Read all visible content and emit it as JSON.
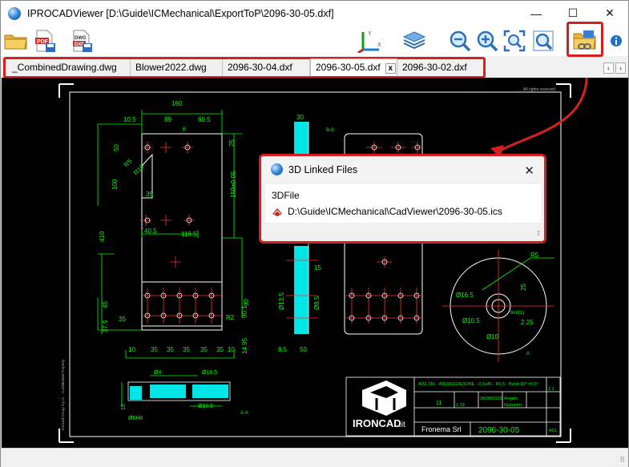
{
  "window": {
    "title": "IPROCADViewer  [D:\\Guide\\ICMechanical\\ExportToP\\2096-30-05.dxf]",
    "minimize_glyph": "—",
    "maximize_glyph": "☐",
    "close_glyph": "✕"
  },
  "toolbar": {
    "buttons": [
      {
        "name": "open-folder-icon"
      },
      {
        "name": "export-pdf-icon"
      },
      {
        "name": "export-dwg-dxf-icon"
      },
      {
        "name": "coordinate-axes-icon"
      },
      {
        "name": "layers-icon"
      },
      {
        "name": "zoom-out-icon"
      },
      {
        "name": "zoom-in-icon"
      },
      {
        "name": "zoom-extents-icon"
      },
      {
        "name": "zoom-window-icon"
      },
      {
        "name": "linked-files-icon"
      },
      {
        "name": "info-icon"
      }
    ],
    "accent": "#d62020"
  },
  "tabs": {
    "items": [
      {
        "label": "_CombinedDrawing.dwg",
        "active": false
      },
      {
        "label": "Blower2022.dwg",
        "active": false
      },
      {
        "label": "2096-30-04.dxf",
        "active": false
      },
      {
        "label": "2096-30-05.dxf",
        "active": true
      },
      {
        "label": "2096-30-02.dxf",
        "active": false
      }
    ],
    "close_glyph": "x",
    "scroll_left": "‹",
    "scroll_right": "›"
  },
  "drawing": {
    "dims_top": [
      "160",
      "10.5",
      "89",
      "60.5",
      "B"
    ],
    "dims_left": [
      "50",
      "R5",
      "R10",
      "100",
      "35",
      "410",
      "40.5",
      "119.5",
      "37.5",
      "45",
      "35",
      "10"
    ],
    "dims_bottom": [
      "35",
      "35",
      "35",
      "35",
      "35",
      "10"
    ],
    "dims_right": [
      "25",
      "150±0.05",
      "90",
      "R2",
      "90.1",
      "14.95"
    ],
    "side_view_dims": [
      "30",
      "B-B",
      "15",
      "Ø13.5",
      "Ø8.5",
      "8.5",
      "50"
    ],
    "section_dims": [
      "Ø4",
      "Ø16.5",
      "Ø10.5",
      "Ø6H8",
      "15",
      "A-A"
    ],
    "detail_dims": [
      "R5",
      "Ø16.5",
      "25",
      "Ø10.5",
      "6mf(1)",
      "2.25",
      "A",
      "Ø10"
    ],
    "title_block": {
      "company": "IRONCAD",
      "company_suffix": ".it",
      "material": "AISI 316 - ANODIZZAZIONE - 0.5x45 - R0.5 - Bordi 90° ±0.5°",
      "client": "Fronema Srl",
      "drawing_no": "2096-30-05",
      "scale": "1:1",
      "sheet": "A01",
      "date": "28/08/2026",
      "designer": "Angelo",
      "checker": "Giovanni",
      "qty": "11",
      "rev": "2.19"
    },
    "copyright": "All rights reserved",
    "side_note": "Ironcad Group S.p.A. - Confidential Property",
    "line_color": "#00ff00",
    "center_color": "#ff3030",
    "part_color": "#ffffff",
    "cyan_color": "#00e5e5"
  },
  "dialog": {
    "title": "3D Linked Files",
    "close_glyph": "✕",
    "column_label": "3DFile",
    "file_path": "D:\\Guide\\ICMechanical\\CadViewer\\2096-30-05.ics",
    "grip_glyph": "⁞⁞"
  },
  "statusbar": {
    "grip_glyph": "⠿"
  }
}
